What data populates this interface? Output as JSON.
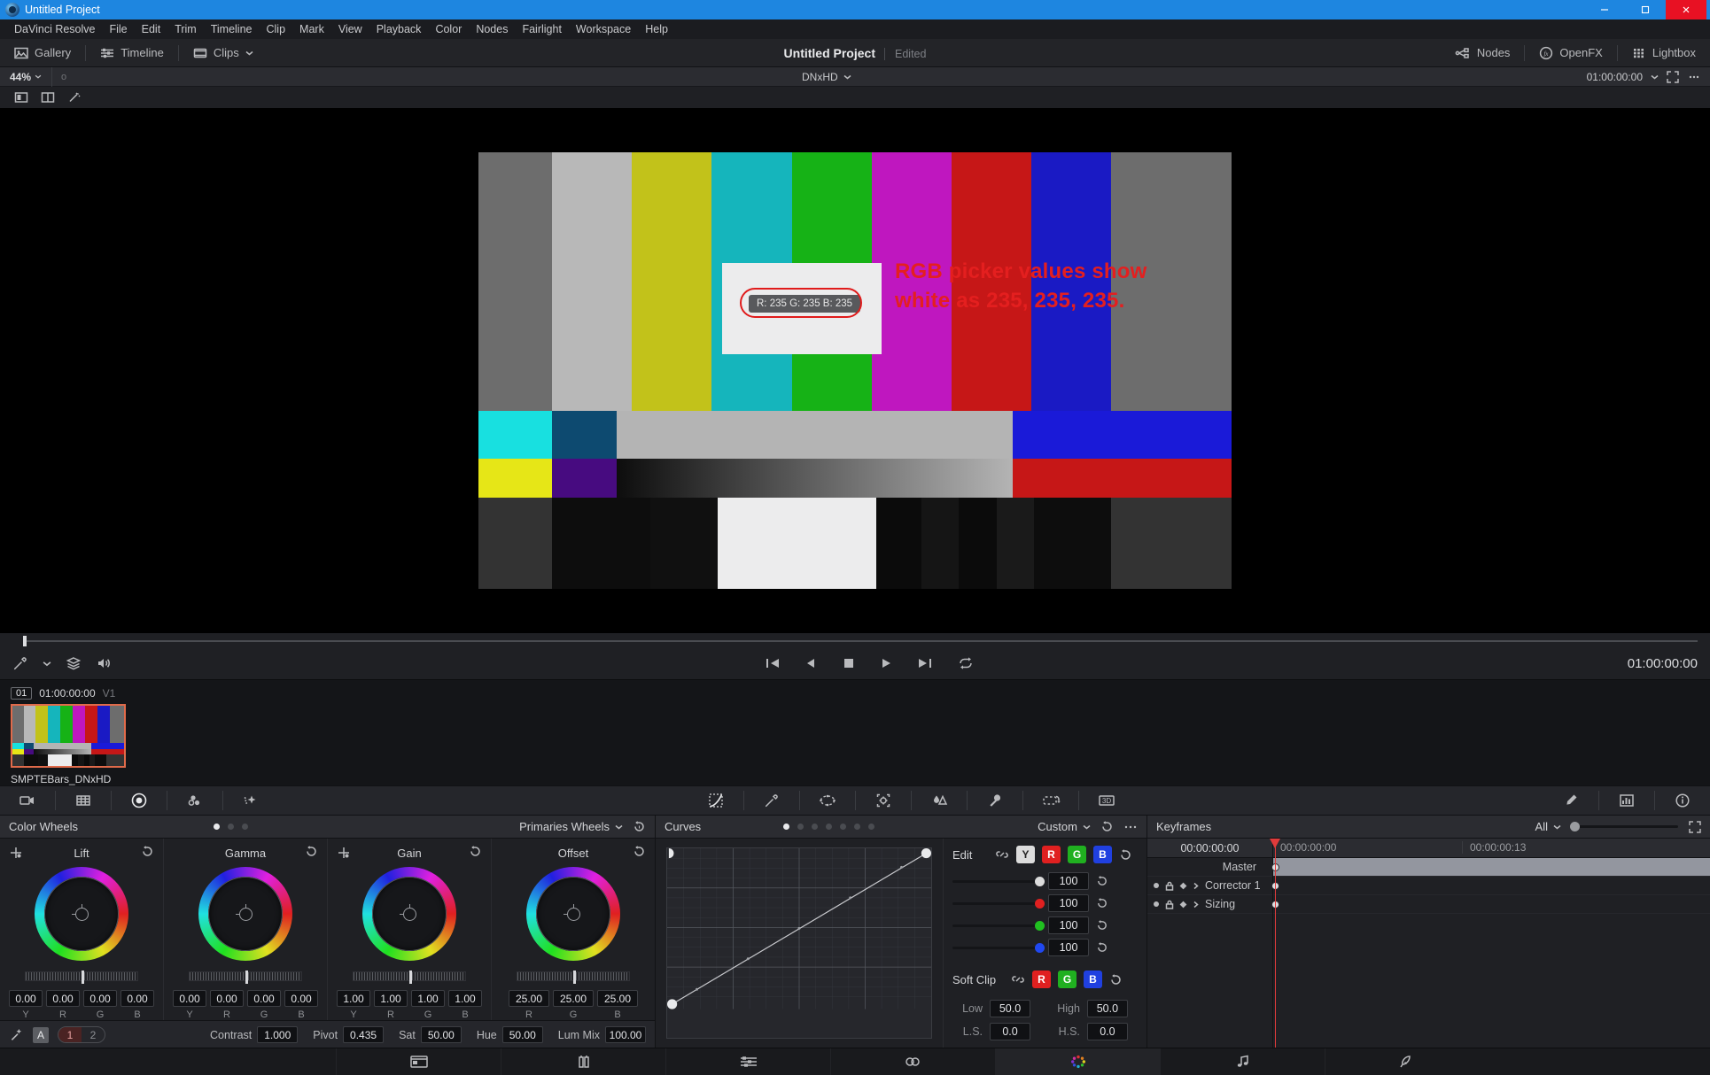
{
  "window": {
    "title": "Untitled Project",
    "minimize": "–",
    "maximize": "❐",
    "close": "✕"
  },
  "menubar": {
    "items": [
      "DaVinci Resolve",
      "File",
      "Edit",
      "Trim",
      "Timeline",
      "Clip",
      "Mark",
      "View",
      "Playback",
      "Color",
      "Nodes",
      "Fairlight",
      "Workspace",
      "Help"
    ]
  },
  "toolbar": {
    "gallery": "Gallery",
    "timeline": "Timeline",
    "clips": "Clips",
    "project_title": "Untitled Project",
    "edited": "Edited",
    "nodes": "Nodes",
    "openfx": "OpenFX",
    "lightbox": "Lightbox"
  },
  "viewerbar": {
    "zoom": "44%",
    "marker": "o",
    "codec": "DNxHD",
    "timecode": "01:00:00:00"
  },
  "viewer": {
    "rgb_pill": "R: 235 G: 235 B: 235",
    "annotation_line1": "RGB picker values show",
    "annotation_line2": "white as 235, 235, 235.",
    "annotation_color": "#e41f1f",
    "bars_top": [
      "#6d6d6d",
      "#b8b8b8",
      "#c2c21a",
      "#15b5bc",
      "#16b216",
      "#bf17bf",
      "#c61717",
      "#1a1ac4",
      "#6d6d6d"
    ],
    "bars_mid": [
      "#18e0e0",
      "#0d4a70",
      "#b4b4b4",
      "#1a1ad8"
    ],
    "bars_bot": [
      "#e6e617",
      "#470b80",
      "#b4b4b4",
      "#c61717"
    ],
    "pluge": [
      "#333333",
      "#0d0d0d",
      "#101010",
      "#ececed",
      "#0b0b0b",
      "#151515",
      "#0b0b0b",
      "#1a1a1a",
      "#0d0d0d",
      "#333333"
    ]
  },
  "transport": {
    "timecode_right": "01:00:00:00",
    "buttons": [
      "skip-back",
      "step-back",
      "stop",
      "play",
      "skip-forward",
      "loop"
    ]
  },
  "clips": {
    "number": "01",
    "timecode": "01:00:00:00",
    "track": "V1",
    "name": "SMPTEBars_DNxHD"
  },
  "color_wheels": {
    "title": "Color Wheels",
    "mode": "Primaries Wheels",
    "wheels": [
      {
        "label": "Lift",
        "fields": [
          "0.00",
          "0.00",
          "0.00",
          "0.00"
        ],
        "subs": [
          "Y",
          "R",
          "G",
          "B"
        ]
      },
      {
        "label": "Gamma",
        "fields": [
          "0.00",
          "0.00",
          "0.00",
          "0.00"
        ],
        "subs": [
          "Y",
          "R",
          "G",
          "B"
        ]
      },
      {
        "label": "Gain",
        "fields": [
          "1.00",
          "1.00",
          "1.00",
          "1.00"
        ],
        "subs": [
          "Y",
          "R",
          "G",
          "B"
        ]
      },
      {
        "label": "Offset",
        "fields": [
          "25.00",
          "25.00",
          "25.00"
        ],
        "subs": [
          "R",
          "G",
          "B"
        ]
      }
    ],
    "footer": {
      "node_a": "A",
      "page1": "1",
      "page2": "2",
      "params": [
        {
          "label": "Contrast",
          "value": "1.000"
        },
        {
          "label": "Pivot",
          "value": "0.435"
        },
        {
          "label": "Sat",
          "value": "50.00"
        },
        {
          "label": "Hue",
          "value": "50.00"
        },
        {
          "label": "Lum Mix",
          "value": "100.00"
        }
      ]
    }
  },
  "curves": {
    "title": "Curves",
    "mode": "Custom",
    "edit_label": "Edit",
    "channels": [
      "Y",
      "R",
      "G",
      "B"
    ],
    "sliders": [
      {
        "channel": "Y",
        "value": "100"
      },
      {
        "channel": "R",
        "value": "100"
      },
      {
        "channel": "G",
        "value": "100"
      },
      {
        "channel": "B",
        "value": "100"
      }
    ],
    "soft_clip": {
      "label": "Soft Clip",
      "channels": [
        "R",
        "G",
        "B"
      ],
      "low_label": "Low",
      "low": "50.0",
      "high_label": "High",
      "high": "50.0",
      "ls_label": "L.S.",
      "ls": "0.0",
      "hs_label": "H.S.",
      "hs": "0.0"
    }
  },
  "keyframes": {
    "title": "Keyframes",
    "filter": "All",
    "timecode": "00:00:00:00",
    "ruler": [
      "00:00:00:00",
      "00:00:00:13"
    ],
    "rows": [
      {
        "label": "Master",
        "type": "master"
      },
      {
        "label": "Corrector 1",
        "type": "track"
      },
      {
        "label": "Sizing",
        "type": "track"
      }
    ]
  },
  "pagenav": {
    "pages": [
      "media",
      "cut",
      "edit",
      "fusion",
      "color",
      "fairlight",
      "deliver"
    ]
  }
}
